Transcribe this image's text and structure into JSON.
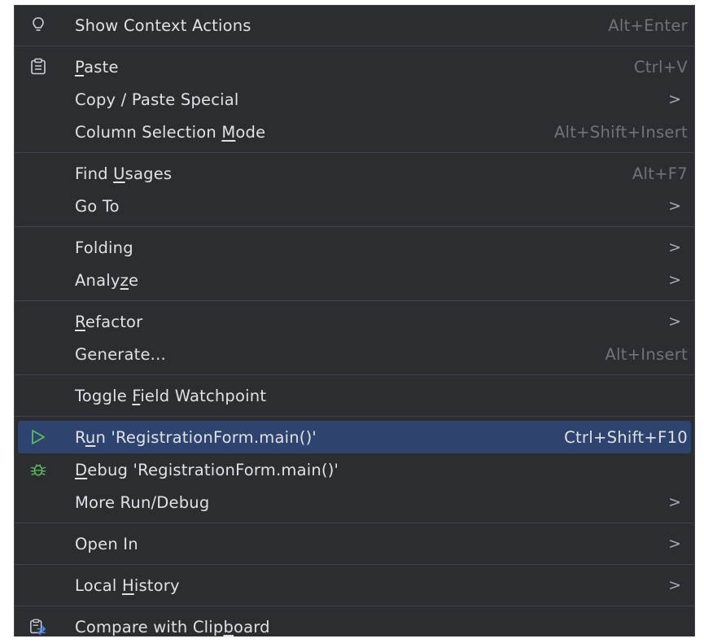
{
  "menu": {
    "items": [
      {
        "label": "Show Context Actions",
        "shortcut": "Alt+Enter",
        "icon": "lightbulb-icon"
      },
      {
        "label_pre": "",
        "label_u": "P",
        "label_post": "aste",
        "shortcut": "Ctrl+V",
        "icon": "clipboard-icon"
      },
      {
        "label": "Copy / Paste Special",
        "submenu": ">"
      },
      {
        "label_pre": "Column Selection ",
        "label_u": "M",
        "label_post": "ode",
        "shortcut": "Alt+Shift+Insert"
      },
      {
        "label_pre": "Find ",
        "label_u": "U",
        "label_post": "sages",
        "shortcut": "Alt+F7"
      },
      {
        "label": "Go To",
        "submenu": ">"
      },
      {
        "label": "Folding",
        "submenu": ">"
      },
      {
        "label_pre": "Analy",
        "label_u": "z",
        "label_post": "e",
        "submenu": ">"
      },
      {
        "label_pre": "",
        "label_u": "R",
        "label_post": "efactor",
        "submenu": ">"
      },
      {
        "label": "Generate...",
        "shortcut": "Alt+Insert"
      },
      {
        "label_pre": "Toggle ",
        "label_u": "F",
        "label_post": "ield Watchpoint"
      },
      {
        "label_pre": "R",
        "label_u": "u",
        "label_post": "n 'RegistrationForm.main()'",
        "shortcut": "Ctrl+Shift+F10",
        "icon": "run-icon",
        "highlighted": true
      },
      {
        "label_pre": "",
        "label_u": "D",
        "label_post": "ebug 'RegistrationForm.main()'",
        "icon": "debug-icon"
      },
      {
        "label": "More Run/Debug",
        "submenu": ">"
      },
      {
        "label": "Open In",
        "submenu": ">"
      },
      {
        "label_pre": "Local ",
        "label_u": "H",
        "label_post": "istory",
        "submenu": ">"
      },
      {
        "label_pre": "Compare with Clip",
        "label_u": "b",
        "label_post": "oard",
        "icon": "compare-clipboard-icon"
      }
    ]
  },
  "colors": {
    "background": "#2b2d30",
    "highlight": "#2e436e",
    "run_green": "#5fb865",
    "debug_green": "#5fb865"
  }
}
